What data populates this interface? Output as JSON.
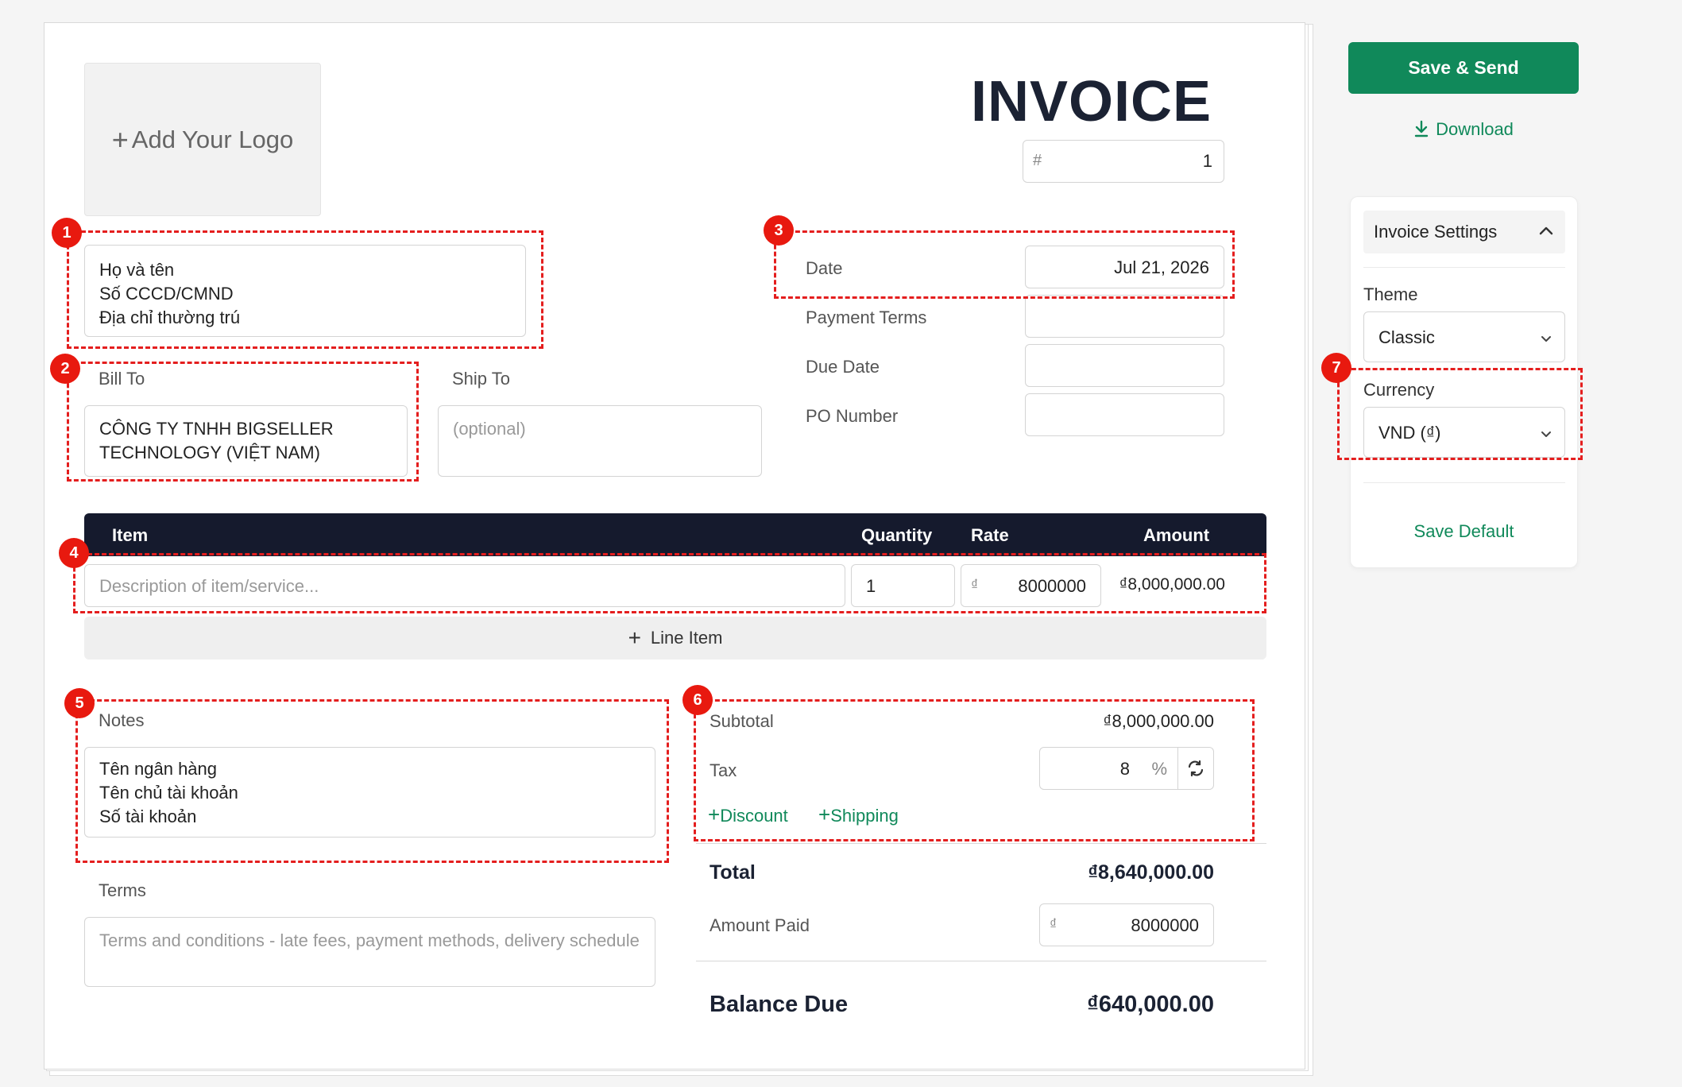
{
  "invoice": {
    "logo_label": "Add Your Logo",
    "title": "INVOICE",
    "number_prefix": "#",
    "number": "1",
    "from_text": "Họ và tên\nSố CCCD/CMND\nĐịa chỉ thường trú",
    "bill_to_label": "Bill To",
    "bill_to_text": "CÔNG TY TNHH BIGSELLER\nTECHNOLOGY (VIỆT NAM)",
    "ship_to_label": "Ship To",
    "ship_to_placeholder": "(optional)",
    "date_label": "Date",
    "date_value": "Jul 21, 2026",
    "payment_terms_label": "Payment Terms",
    "due_date_label": "Due Date",
    "po_number_label": "PO Number"
  },
  "table": {
    "headers": {
      "item": "Item",
      "quantity": "Quantity",
      "rate": "Rate",
      "amount": "Amount"
    },
    "rows": [
      {
        "description_placeholder": "Description of item/service...",
        "quantity": "1",
        "currency_symbol": "₫",
        "rate": "8000000",
        "amount": "₫8,000,000.00"
      }
    ],
    "add_line_label": "Line Item"
  },
  "notes": {
    "label": "Notes",
    "text": "Tên ngân hàng\nTên chủ tài khoản\nSố tài khoản"
  },
  "terms": {
    "label": "Terms",
    "placeholder": "Terms and conditions - late fees, payment methods, delivery schedule"
  },
  "totals": {
    "subtotal_label": "Subtotal",
    "subtotal_value": "₫8,000,000.00",
    "tax_label": "Tax",
    "tax_value": "8",
    "tax_unit": "%",
    "discount_label": "Discount",
    "shipping_label": "Shipping",
    "total_label": "Total",
    "total_value": "₫8,640,000.00",
    "amount_paid_label": "Amount Paid",
    "amount_paid_symbol": "₫",
    "amount_paid_value": "8000000",
    "balance_due_label": "Balance Due",
    "balance_due_value": "₫640,000.00"
  },
  "sidebar": {
    "save_send_label": "Save & Send",
    "download_label": "Download",
    "settings_title": "Invoice Settings",
    "theme_label": "Theme",
    "theme_value": "Classic",
    "currency_label": "Currency",
    "currency_value": "VND (₫)",
    "save_default_label": "Save Default"
  },
  "annotations": [
    "1",
    "2",
    "3",
    "4",
    "5",
    "6",
    "7"
  ],
  "colors": {
    "accent_green": "#10895a",
    "header_dark": "#151a2d",
    "annotation_red": "#e41e1e"
  },
  "icons": [
    "plus-icon",
    "download-icon",
    "chevron-up-icon",
    "chevron-down-icon",
    "swap-icon"
  ]
}
